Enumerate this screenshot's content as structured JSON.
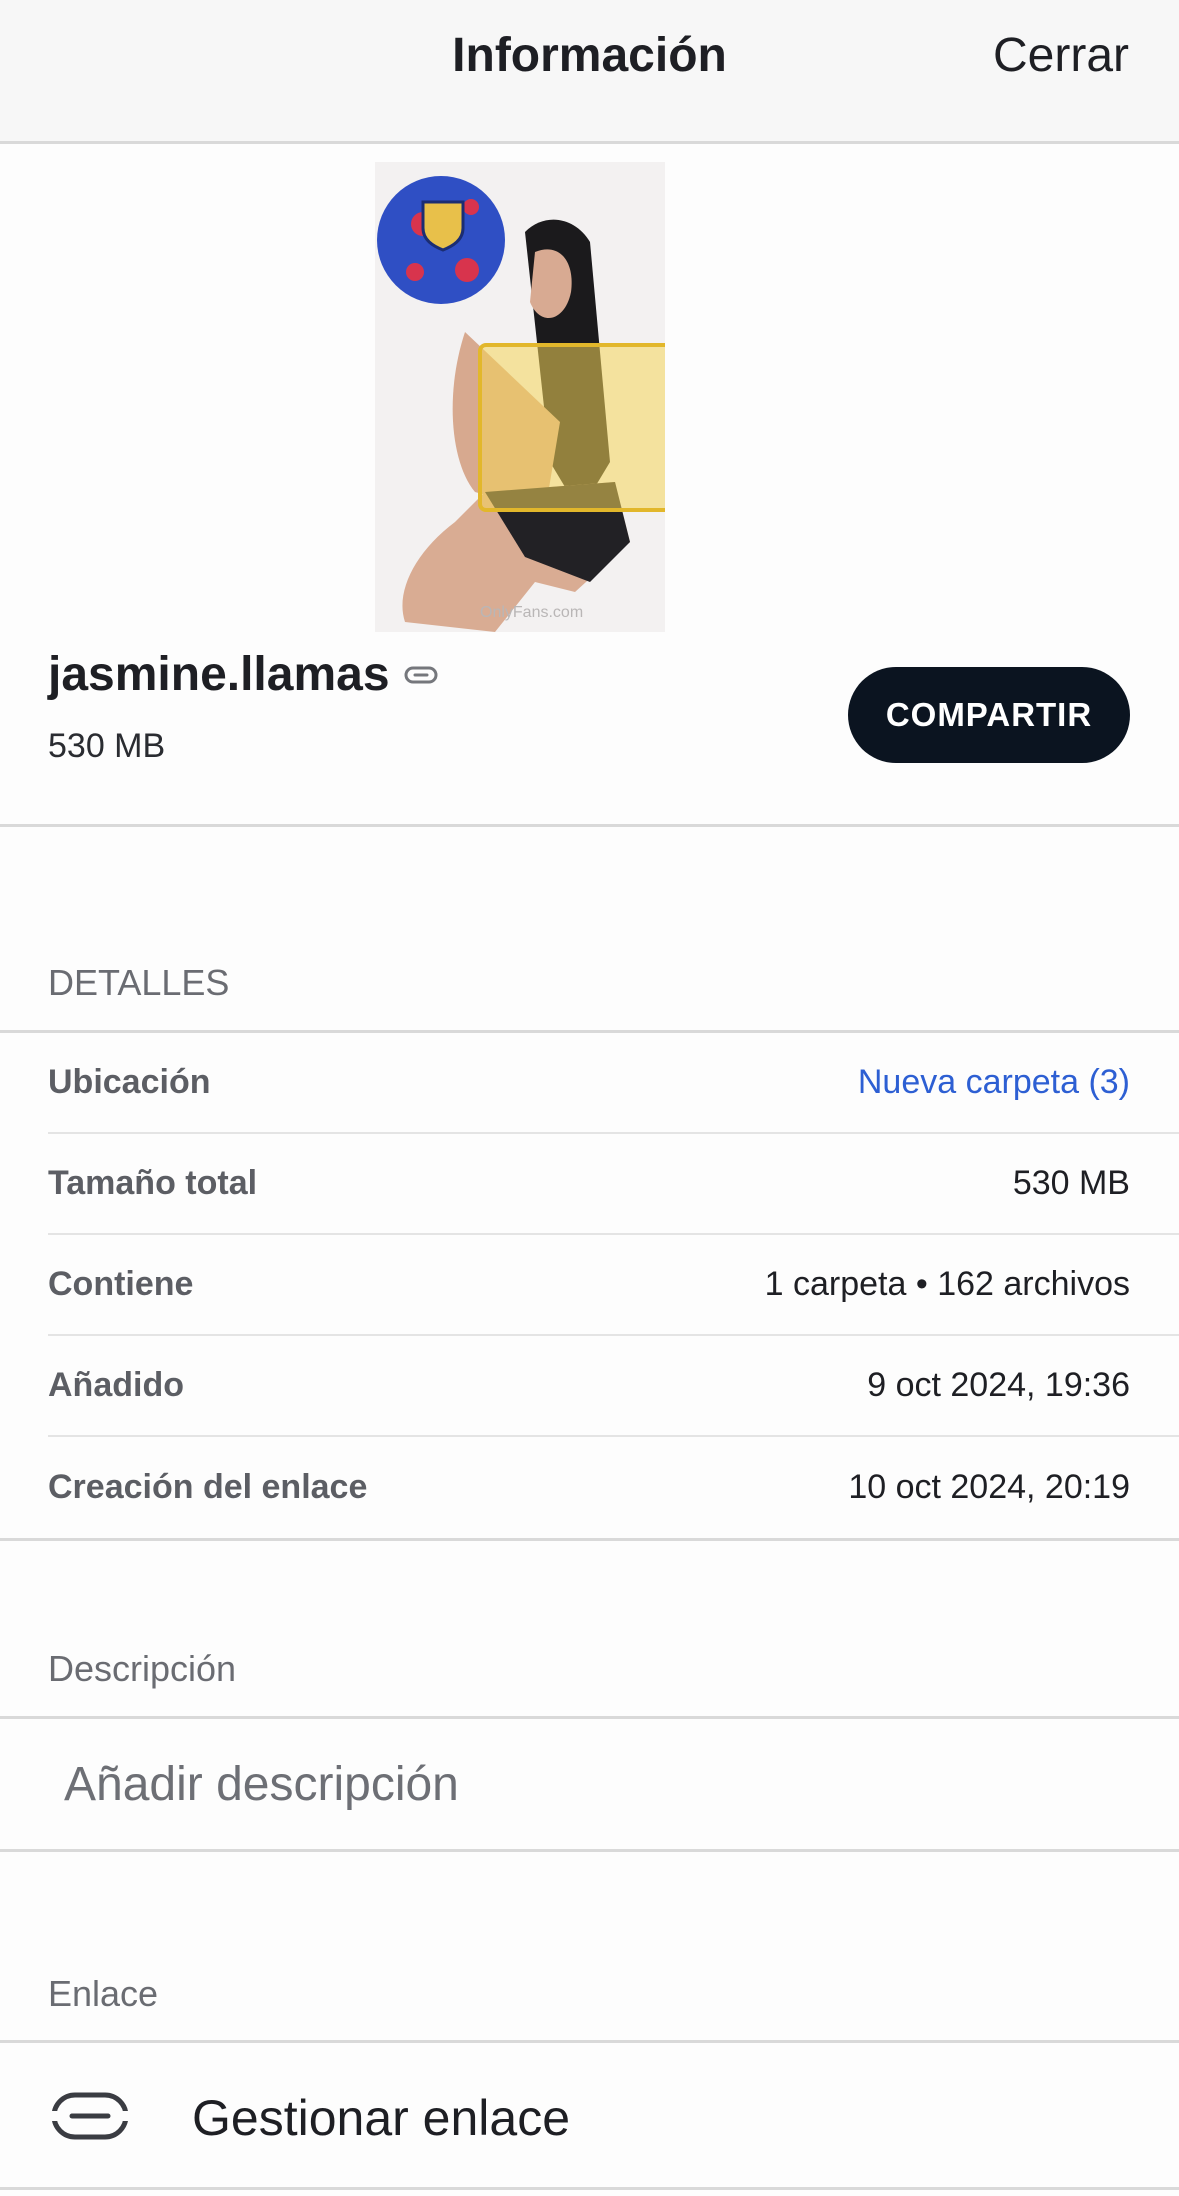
{
  "header": {
    "title": "Información",
    "close_label": "Cerrar"
  },
  "file": {
    "name": "jasmine.llamas",
    "size": "530 MB",
    "share_label": "COMPARTIR",
    "thumbnail_watermark": "OnlyFans.com"
  },
  "details": {
    "section_label": "DETALLES",
    "rows": [
      {
        "key": "Ubicación",
        "value": "Nueva carpeta (3)"
      },
      {
        "key": "Tamaño total",
        "value": "530 MB"
      },
      {
        "key": "Contiene",
        "value": "1 carpeta • 162 archivos"
      },
      {
        "key": "Añadido",
        "value": "9 oct 2024, 19:36"
      },
      {
        "key": "Creación del enlace",
        "value": "10 oct 2024, 20:19"
      }
    ]
  },
  "description": {
    "section_label": "Descripción",
    "placeholder": "Añadir descripción"
  },
  "link": {
    "section_label": "Enlace",
    "manage_label": "Gestionar enlace"
  },
  "icons": {
    "title_link": "link-icon",
    "manage_link": "link-icon"
  },
  "colors": {
    "accent_link": "#2d5fd3",
    "share_button_bg": "#0b1420",
    "header_bg": "#f7f7f7"
  }
}
